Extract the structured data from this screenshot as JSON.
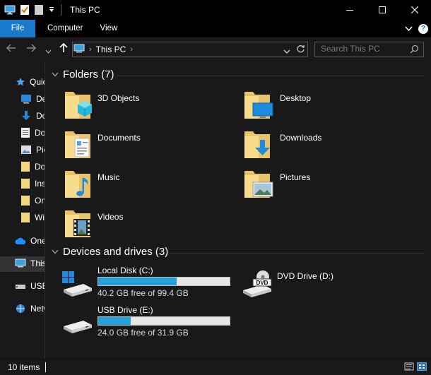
{
  "window": {
    "title": "This PC",
    "controls": {
      "minimize": "minimize-icon",
      "maximize": "maximize-icon",
      "close": "close-icon"
    }
  },
  "ribbon": {
    "tabs": [
      {
        "label": "File",
        "active": true
      },
      {
        "label": "Computer"
      },
      {
        "label": "View"
      }
    ],
    "accent": "#1979ca",
    "help": "?"
  },
  "nav": {
    "address": "This PC",
    "search_placeholder": "Search This PC"
  },
  "sidebar": {
    "items": [
      {
        "label": "Quick access",
        "icon": "star-icon"
      },
      {
        "label": "Desktop",
        "icon": "desktop-icon"
      },
      {
        "label": "Downloads",
        "icon": "download-icon"
      },
      {
        "label": "Documents",
        "icon": "documents-icon"
      },
      {
        "label": "Pictures",
        "icon": "pictures-icon"
      },
      {
        "label": "Documents",
        "icon": "folder-icon"
      },
      {
        "label": "Installers",
        "icon": "folder-icon"
      },
      {
        "label": "OneDrive",
        "icon": "folder-icon"
      },
      {
        "label": "Windows",
        "icon": "folder-icon"
      },
      {
        "label": "OneDrive",
        "icon": "cloud-icon"
      },
      {
        "label": "This PC",
        "icon": "computer-icon",
        "selected": true
      },
      {
        "label": "USB Drive (E:)",
        "icon": "usb-icon"
      },
      {
        "label": "Network",
        "icon": "network-icon"
      }
    ]
  },
  "folders": {
    "title": "Folders (7)",
    "items": [
      {
        "label": "3D Objects",
        "icon": "3d-objects-folder-icon"
      },
      {
        "label": "Desktop",
        "icon": "desktop-folder-icon"
      },
      {
        "label": "Documents",
        "icon": "documents-folder-icon"
      },
      {
        "label": "Downloads",
        "icon": "downloads-folder-icon"
      },
      {
        "label": "Music",
        "icon": "music-folder-icon"
      },
      {
        "label": "Pictures",
        "icon": "pictures-folder-icon"
      },
      {
        "label": "Videos",
        "icon": "videos-folder-icon"
      }
    ]
  },
  "devices": {
    "title": "Devices and drives (3)",
    "items": [
      {
        "label": "Local Disk (C:)",
        "free": "40.2 GB free of 99.4 GB",
        "used_fraction": 0.596,
        "icon": "windows-drive-icon"
      },
      {
        "label": "DVD Drive (D:)",
        "icon": "dvd-drive-icon",
        "badge": "DVD"
      },
      {
        "label": "USB Drive (E:)",
        "free": "24.0 GB free of 31.9 GB",
        "used_fraction": 0.248,
        "icon": "usb-drive-icon"
      }
    ],
    "bar_color": "#26a0da"
  },
  "status": {
    "items": "10 items"
  }
}
